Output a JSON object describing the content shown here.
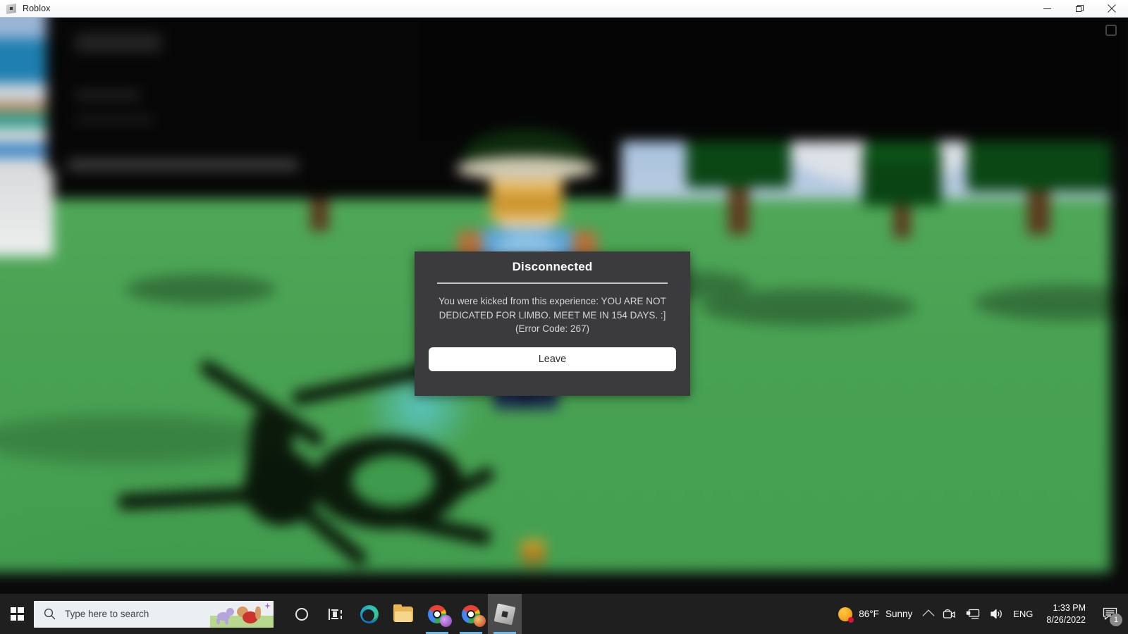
{
  "window": {
    "title": "Roblox",
    "app_icon": "roblox-cube-icon",
    "controls": {
      "minimize": "minimize-icon",
      "restore": "restore-icon",
      "close": "close-icon"
    }
  },
  "dialog": {
    "title": "Disconnected",
    "message": "You were kicked from this experience: YOU ARE NOT DEDICATED FOR LIMBO. MEET ME IN 154 DAYS. :]\n(Error Code: 267)",
    "message_line1": "You were kicked from this experience: YOU ARE NOT",
    "message_line2": "DEDICATED FOR LIMBO. MEET ME IN 154 DAYS. :]",
    "message_line3": "(Error Code: 267)",
    "error_code": "267",
    "button_label": "Leave",
    "bg_color": "#3b3b3d",
    "button_bg": "#ffffff",
    "text_color": "#d5d5d5"
  },
  "taskbar": {
    "start": "windows-logo",
    "search": {
      "placeholder": "Type here to search",
      "icon": "search-icon"
    },
    "items": [
      {
        "name": "cortana",
        "label": "Cortana",
        "icon": "circle-icon",
        "active": false,
        "running": false
      },
      {
        "name": "task-view",
        "label": "Task View",
        "icon": "task-view-icon",
        "active": false,
        "running": false
      },
      {
        "name": "edge",
        "label": "Microsoft Edge",
        "icon": "edge-icon",
        "active": false,
        "running": false
      },
      {
        "name": "file-explorer",
        "label": "File Explorer",
        "icon": "folder-icon",
        "active": false,
        "running": false
      },
      {
        "name": "chrome-1",
        "label": "Google Chrome",
        "icon": "chrome-icon",
        "active": false,
        "running": true
      },
      {
        "name": "chrome-2",
        "label": "Google Chrome",
        "icon": "chrome-icon",
        "active": false,
        "running": true
      },
      {
        "name": "roblox",
        "label": "Roblox",
        "icon": "roblox-cube-icon",
        "active": true,
        "running": true
      }
    ],
    "tray": {
      "weather_temp": "86°F",
      "weather_condition": "Sunny",
      "weather_icon": "sun-icon",
      "overflow_icon": "chevron-up-icon",
      "icons": [
        {
          "name": "onedrive-camera-icon"
        },
        {
          "name": "network-icon"
        },
        {
          "name": "volume-icon"
        }
      ],
      "language": "ENG",
      "time": "1:33 PM",
      "date": "8/26/2022",
      "notifications_icon": "notification-bubble-icon",
      "notifications_count": "1"
    }
  },
  "scene": {
    "description": "blurred Roblox game world",
    "colors": {
      "sky": "#a7c0de",
      "ground": "#49a253",
      "tree_foliage": "#0f5a1b",
      "tree_trunk": "#5b3a1e",
      "building": "#060606",
      "accent_blue": "#5da4d6"
    }
  }
}
